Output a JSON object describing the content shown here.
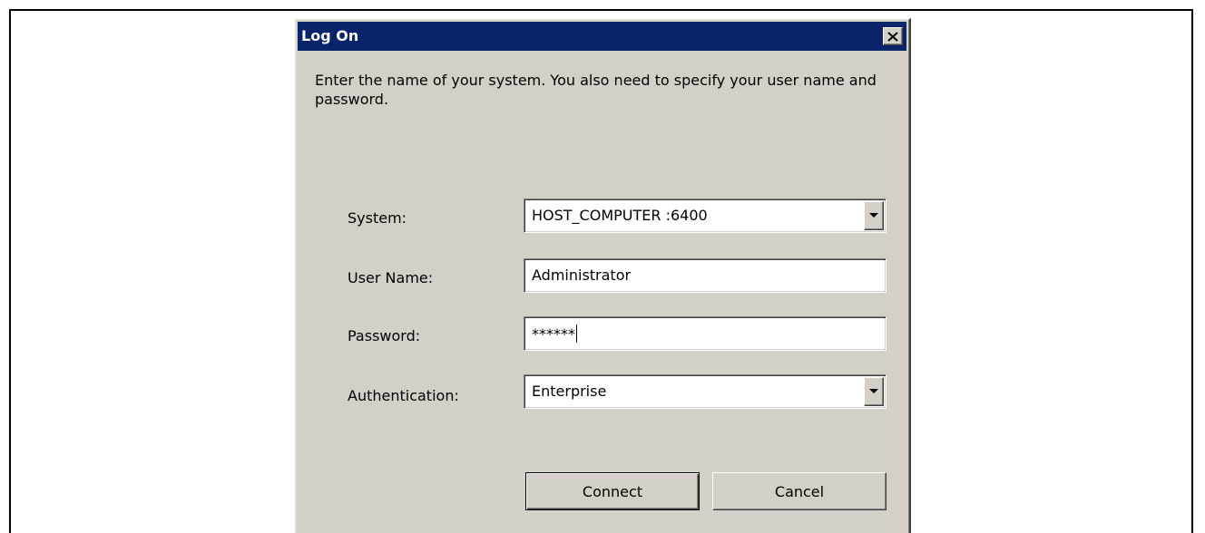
{
  "window": {
    "title": "Log On",
    "close_icon": "close-icon"
  },
  "description": "Enter the name of your system. You also need to specify your user name and password.",
  "form": {
    "system": {
      "label": "System:",
      "value": "HOST_COMPUTER :6400"
    },
    "user_name": {
      "label": "User Name:",
      "value": "Administrator"
    },
    "password": {
      "label": "Password:",
      "value": "******"
    },
    "authentication": {
      "label": "Authentication:",
      "value": "Enterprise"
    }
  },
  "buttons": {
    "connect": "Connect",
    "cancel": "Cancel"
  },
  "colors": {
    "titlebar": "#0a246a",
    "dialog_bg": "#d4d0c8"
  }
}
